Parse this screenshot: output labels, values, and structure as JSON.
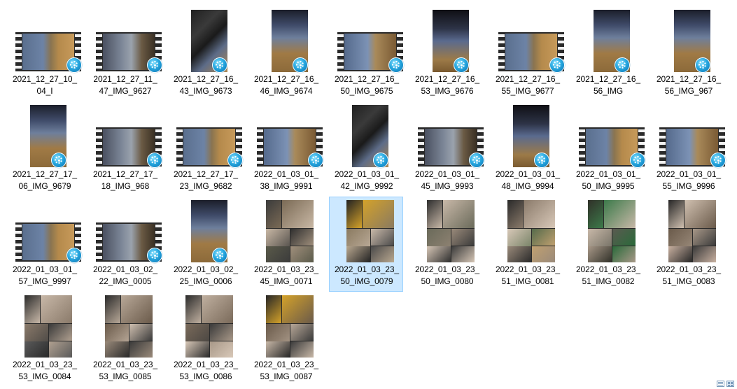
{
  "files": [
    {
      "line1": "2021_12_27_10_",
      "line2": "04_I",
      "kind": "video-landscape",
      "scene": "a"
    },
    {
      "line1": "2021_12_27_11_",
      "line2": "47_IMG_9627",
      "kind": "video-landscape",
      "scene": "b"
    },
    {
      "line1": "2021_12_27_16_",
      "line2": "43_IMG_9673",
      "kind": "video-portrait",
      "scene": "e"
    },
    {
      "line1": "2021_12_27_16_",
      "line2": "46_IMG_9674",
      "kind": "video-portrait",
      "scene": "c"
    },
    {
      "line1": "2021_12_27_16_",
      "line2": "50_IMG_9675",
      "kind": "video-landscape",
      "scene": "d"
    },
    {
      "line1": "2021_12_27_16_",
      "line2": "53_IMG_9676",
      "kind": "video-portrait",
      "scene": "f"
    },
    {
      "line1": "2021_12_27_16_",
      "line2": "55_IMG_9677",
      "kind": "video-landscape",
      "scene": "a"
    },
    {
      "line1": "2021_12_27_16_",
      "line2": "56_IMG",
      "kind": "video-portrait",
      "scene": "c"
    },
    {
      "line1": "2021_12_27_16_",
      "line2": "56_IMG_967",
      "kind": "video-portrait",
      "scene": "c"
    },
    {
      "line1": "2021_12_27_17_",
      "line2": "06_IMG_9679",
      "kind": "video-portrait",
      "scene": "c"
    },
    {
      "line1": "2021_12_27_17_",
      "line2": "18_IMG_968",
      "kind": "video-landscape",
      "scene": "b"
    },
    {
      "line1": "2021_12_27_17_",
      "line2": "23_IMG_9682",
      "kind": "video-landscape",
      "scene": "a"
    },
    {
      "line1": "2022_01_03_01_",
      "line2": "38_IMG_9991",
      "kind": "video-landscape",
      "scene": "d"
    },
    {
      "line1": "2022_01_03_01_",
      "line2": "42_IMG_9992",
      "kind": "video-portrait",
      "scene": "e"
    },
    {
      "line1": "2022_01_03_01_",
      "line2": "45_IMG_9993",
      "kind": "video-landscape",
      "scene": "b"
    },
    {
      "line1": "2022_01_03_01_",
      "line2": "48_IMG_9994",
      "kind": "video-portrait",
      "scene": "f"
    },
    {
      "line1": "2022_01_03_01_",
      "line2": "50_IMG_9995",
      "kind": "video-landscape",
      "scene": "a"
    },
    {
      "line1": "2022_01_03_01_",
      "line2": "55_IMG_9996",
      "kind": "video-landscape",
      "scene": "d"
    },
    {
      "line1": "2022_01_03_01_",
      "line2": "57_IMG_9997",
      "kind": "video-landscape",
      "scene": "a"
    },
    {
      "line1": "2022_01_03_02_",
      "line2": "22_IMG_0005",
      "kind": "video-landscape",
      "scene": "b"
    },
    {
      "line1": "2022_01_03_02_",
      "line2": "25_IMG_0006",
      "kind": "video-portrait",
      "scene": "c"
    },
    {
      "line1": "2022_01_03_23_",
      "line2": "45_IMG_0071",
      "kind": "photo",
      "palette": [
        "#3b3b3b",
        "#7a6a55",
        "#c9b8a5",
        "#2f2f2f",
        "#a08f7c",
        "#5a5a4a"
      ]
    },
    {
      "line1": "2022_01_03_23_",
      "line2": "50_IMG_0079",
      "kind": "photo",
      "selected": true,
      "palette": [
        "#222222",
        "#d4a22a",
        "#8a7a60",
        "#c9b9a9",
        "#4a4a4a",
        "#b9a890"
      ]
    },
    {
      "line1": "2022_01_03_23_",
      "line2": "50_IMG_0080",
      "kind": "photo",
      "palette": [
        "#2e2e2e",
        "#c8b8a8",
        "#6a6a5a",
        "#9a8a7a",
        "#3a3a3a",
        "#d6c6b6"
      ]
    },
    {
      "line1": "2022_01_03_23_",
      "line2": "51_IMG_0081",
      "kind": "photo",
      "palette": [
        "#2a2a2a",
        "#8a7a6a",
        "#d8c8b8",
        "#556a4a",
        "#c0a070",
        "#9a8a7a"
      ]
    },
    {
      "line1": "2022_01_03_23_",
      "line2": "51_IMG_0082",
      "kind": "photo",
      "palette": [
        "#303028",
        "#3c7a4a",
        "#c8b8a8",
        "#5a5a50",
        "#2a6a3a",
        "#a89888"
      ]
    },
    {
      "line1": "2022_01_03_23_",
      "line2": "51_IMG_0083",
      "kind": "photo",
      "palette": [
        "#262626",
        "#d0c0b0",
        "#6a5a4a",
        "#a89888",
        "#3a3a3a",
        "#c8b0a0"
      ]
    },
    {
      "line1": "2022_01_03_23_",
      "line2": "53_IMG_0084",
      "kind": "photo",
      "palette": [
        "#2a2a2a",
        "#c8b8a8",
        "#8a7a6a",
        "#3a3a3a",
        "#b0a090",
        "#5a5a5a"
      ]
    },
    {
      "line1": "2022_01_03_23_",
      "line2": "53_IMG_0085",
      "kind": "photo",
      "palette": [
        "#2a2a2a",
        "#b8a898",
        "#6a5a4a",
        "#d0c0b0",
        "#3a3a3a",
        "#9a8a7a"
      ]
    },
    {
      "line1": "2022_01_03_23_",
      "line2": "53_IMG_0086",
      "kind": "photo",
      "palette": [
        "#2a2a2a",
        "#c0b0a0",
        "#7a6a5a",
        "#3a3a3a",
        "#a89888",
        "#d8c8b8"
      ]
    },
    {
      "line1": "2022_01_03_23_",
      "line2": "53_IMG_0087",
      "kind": "photo",
      "palette": [
        "#262626",
        "#d4a22a",
        "#6a5a4a",
        "#b8a898",
        "#3a3a3a",
        "#c8b8a8"
      ]
    }
  ],
  "view_icons": [
    "details-view-icon",
    "large-icons-view-icon"
  ]
}
